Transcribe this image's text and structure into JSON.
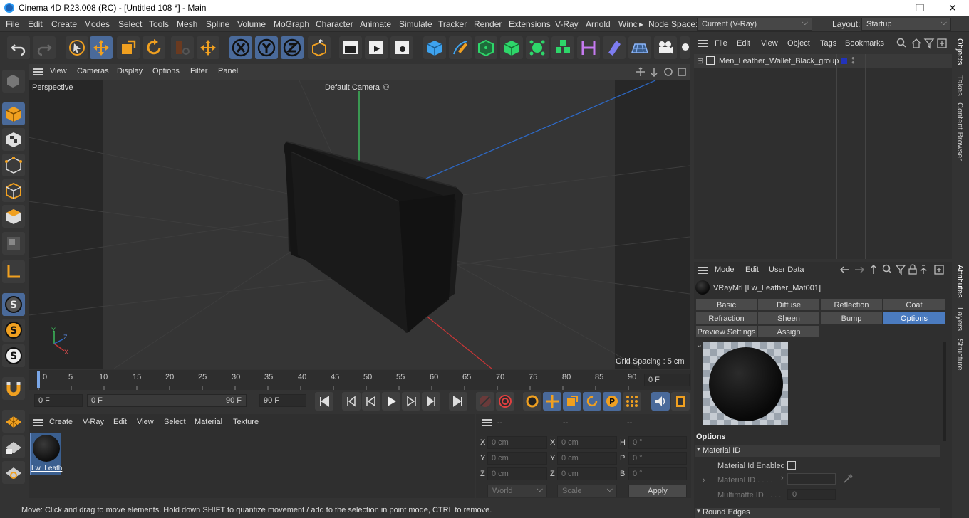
{
  "window": {
    "title": "Cinema 4D R23.008 (RC) - [Untitled 108 *] - Main",
    "min": "—",
    "max": "❐",
    "close": "✕"
  },
  "menu": {
    "items": [
      "File",
      "Edit",
      "Create",
      "Modes",
      "Select",
      "Tools",
      "Mesh",
      "Spline",
      "Volume",
      "MoGraph",
      "Character",
      "Animate",
      "Simulate",
      "Tracker",
      "Render",
      "Extensions",
      "V-Ray",
      "Arnold",
      "Winc"
    ],
    "more": "▸",
    "node_space_label": "Node Space:",
    "node_space_value": "Current (V-Ray)",
    "layout_label": "Layout:",
    "layout_value": "Startup"
  },
  "viewport": {
    "menu": [
      "View",
      "Cameras",
      "Display",
      "Options",
      "Filter",
      "Panel"
    ],
    "label": "Perspective",
    "camera": "Default Camera",
    "camera_icon": "⚇",
    "grid": "Grid Spacing : 5 cm",
    "axis_x": "X",
    "axis_y": "Y",
    "axis_z": "Z"
  },
  "timeline": {
    "ticks": [
      "0",
      "5",
      "10",
      "15",
      "20",
      "25",
      "30",
      "35",
      "40",
      "45",
      "50",
      "55",
      "60",
      "65",
      "70",
      "75",
      "80",
      "85",
      "90"
    ],
    "current": "0 F"
  },
  "transport": {
    "start": "0 F",
    "range_start": "0 F",
    "range_end": "90 F",
    "end": "90 F"
  },
  "materials": {
    "menu": [
      "Create",
      "V-Ray",
      "Edit",
      "View",
      "Select",
      "Material",
      "Texture"
    ],
    "item": "Lw_Leath"
  },
  "coords": {
    "headers": [
      "--",
      "--",
      "--"
    ],
    "rows": [
      {
        "a": "X",
        "av": "0 cm",
        "b": "X",
        "bv": "0 cm",
        "c": "H",
        "cv": "0 °"
      },
      {
        "a": "Y",
        "av": "0 cm",
        "b": "Y",
        "bv": "0 cm",
        "c": "P",
        "cv": "0 °"
      },
      {
        "a": "Z",
        "av": "0 cm",
        "b": "Z",
        "bv": "0 cm",
        "c": "B",
        "cv": "0 °"
      }
    ],
    "world": "World",
    "scale": "Scale",
    "apply": "Apply"
  },
  "objects": {
    "menu": [
      "File",
      "Edit",
      "View",
      "Object",
      "Tags",
      "Bookmarks"
    ],
    "item": "Men_Leather_Wallet_Black_group"
  },
  "attributes": {
    "menu": [
      "Mode",
      "Edit",
      "User Data"
    ],
    "material": "VRayMtl [Lw_Leather_Mat001]",
    "tabs_row1": [
      "Basic",
      "Diffuse",
      "Reflection",
      "Coat"
    ],
    "tabs_row2": [
      "Refraction",
      "Sheen",
      "Bump",
      "Options"
    ],
    "tabs_row3": [
      "Preview Settings",
      "Assign"
    ],
    "section": "Options",
    "group1": "Material ID",
    "mid_enabled": "Material Id Enabled",
    "mid": "Material ID . . . .",
    "multimatte": "Multimatte ID . . . .",
    "multimatte_val": "0",
    "group2": "Round Edges"
  },
  "right_tabs": [
    "Objects",
    "Takes",
    "Content Browser",
    "Attributes",
    "Layers",
    "Structure"
  ],
  "status": "Move: Click and drag to move elements. Hold down SHIFT to quantize movement / add to the selection in point mode, CTRL to remove."
}
